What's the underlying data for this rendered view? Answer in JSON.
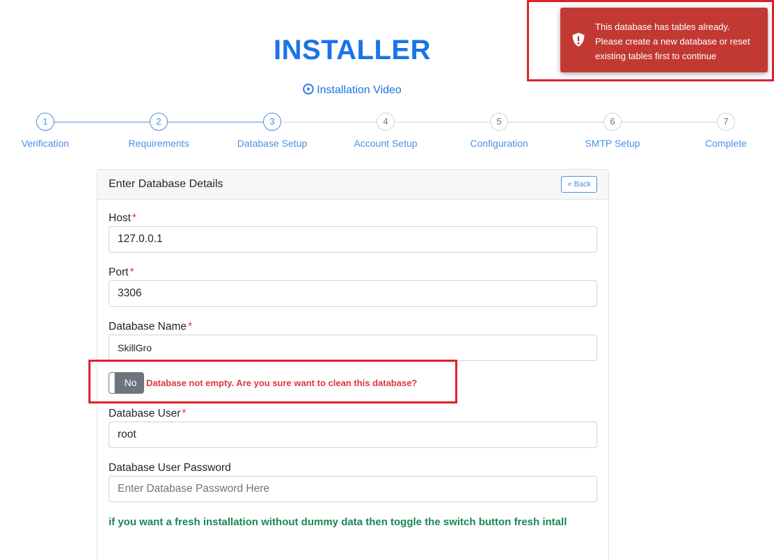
{
  "page": {
    "title": "INSTALLER",
    "video_link": "Installation Video"
  },
  "steps": [
    {
      "number": "1",
      "label": "Verification",
      "status": "done"
    },
    {
      "number": "2",
      "label": "Requirements",
      "status": "done"
    },
    {
      "number": "3",
      "label": "Database Setup",
      "status": "done"
    },
    {
      "number": "4",
      "label": "Account Setup",
      "status": "todo"
    },
    {
      "number": "5",
      "label": "Configuration",
      "status": "todo"
    },
    {
      "number": "6",
      "label": "SMTP Setup",
      "status": "todo"
    },
    {
      "number": "7",
      "label": "Complete",
      "status": "todo"
    }
  ],
  "card": {
    "header": "Enter Database Details",
    "back_label": "« Back"
  },
  "form": {
    "host": {
      "label": "Host",
      "required_mark": "*",
      "value": "127.0.0.1"
    },
    "port": {
      "label": "Port",
      "required_mark": "*",
      "value": "3306"
    },
    "db_name": {
      "label": "Database Name",
      "required_mark": "*",
      "value": "SkillGro"
    },
    "clean_toggle": {
      "state_label": "No",
      "warning": "Database not empty. Are you sure want to clean this database?"
    },
    "db_user": {
      "label": "Database User",
      "required_mark": "*",
      "value": "root"
    },
    "db_password": {
      "label": "Database User Password",
      "placeholder": "Enter Database Password Here"
    },
    "fresh_note": "if you want a fresh installation without dummy data then toggle the switch button fresh intall"
  },
  "toast": {
    "line1": "This database has tables already.",
    "line2": "Please create a new database or reset",
    "line3": "existing tables first to continue"
  },
  "colors": {
    "accent": "#1a73e8",
    "danger": "#dc3545",
    "success": "#198754",
    "toast_bg": "#c23934",
    "highlight": "#e01f2b"
  }
}
